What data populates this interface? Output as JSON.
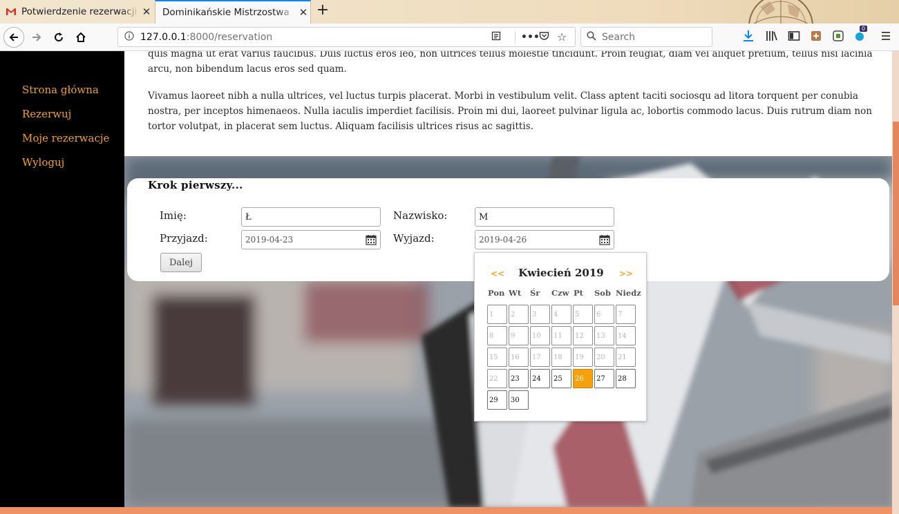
{
  "browser": {
    "tabs": [
      {
        "title": "Potwierdzenie rezerwacji",
        "icon": "gmail-icon"
      },
      {
        "title": "Dominikańskie Mistrzostwa",
        "icon": null
      }
    ],
    "url_host": "127.0.0.1",
    "url_rest": ":8000/reservation",
    "search_placeholder": "Search",
    "badge_count": "0"
  },
  "sidebar": {
    "items": [
      {
        "label": "Strona główna"
      },
      {
        "label": "Rezerwuj"
      },
      {
        "label": "Moje rezerwacje"
      },
      {
        "label": "Wyloguj"
      }
    ]
  },
  "content": {
    "paragraph_1": "quis magna ut erat varius faucibus. Duis luctus eros leo, non ultrices tellus molestie tincidunt. Proin feugiat, diam vel aliquet pretium, tellus nisi lacinia arcu, non bibendum lacus eros sed quam.",
    "paragraph_2": "Vivamus laoreet nibh a nulla ultrices, vel luctus turpis placerat. Morbi in vestibulum velit. Class aptent taciti sociosqu ad litora torquent per conubia nostra, per inceptos himenaeos. Nulla iaculis imperdiet facilisis. Proin mi dui, laoreet pulvinar ligula ac, lobortis commodo lacus. Duis rutrum diam non tortor volutpat, in placerat sem luctus. Aliquam facilisis ultrices risus ac sagittis."
  },
  "form": {
    "title": "Krok pierwszy...",
    "first_name_label": "Imię:",
    "first_name_value": "Ł",
    "last_name_label": "Nazwisko:",
    "last_name_value": "M",
    "arrival_label": "Przyjazd:",
    "arrival_value": "2019-04-23",
    "departure_label": "Wyjazd:",
    "departure_value": "2019-04-26",
    "next_button": "Dalej"
  },
  "datepicker": {
    "prev": "<<",
    "next": ">>",
    "month_title": "Kwiecień 2019",
    "weekdays": [
      "Pon",
      "Wt",
      "Śr",
      "Czw",
      "Pt",
      "Sob",
      "Niedz"
    ],
    "days": [
      "1",
      "2",
      "3",
      "4",
      "5",
      "6",
      "7",
      "8",
      "9",
      "10",
      "11",
      "12",
      "13",
      "14",
      "15",
      "16",
      "17",
      "18",
      "19",
      "20",
      "21",
      "22",
      "23",
      "24",
      "25",
      "26",
      "27",
      "28",
      "29",
      "30"
    ],
    "disabled_through": 22,
    "selected_day": 26,
    "first_weekday_offset": 0
  },
  "colors": {
    "accent": "#f0a21e",
    "selected": "#f5a10c",
    "sidebar_bg": "#000000",
    "scroll_thumb": "#e5875e"
  }
}
